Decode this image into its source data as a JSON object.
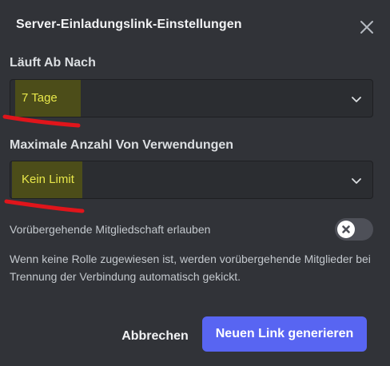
{
  "modal": {
    "title": "Server-Einladungslink-Einstellungen"
  },
  "expire": {
    "label": "Läuft Ab Nach",
    "value": "7 Tage"
  },
  "max_uses": {
    "label": "Maximale Anzahl Von Verwendungen",
    "value": "Kein Limit"
  },
  "temporary": {
    "label": "Vorübergehende Mitgliedschaft erlauben",
    "enabled": false,
    "description": "Wenn keine Rolle zugewiesen ist, werden vorübergehende Mitglieder bei Trennung der Verbindung automatisch gekickt."
  },
  "footer": {
    "cancel_label": "Abbrechen",
    "generate_label": "Neuen Link generieren"
  },
  "colors": {
    "background": "#313338",
    "select_bg": "#2b2d31",
    "accent": "#5865f2",
    "highlight_text": "#e8e84a",
    "annotation": "#e0151b"
  },
  "icons": {
    "close": "close-icon",
    "dropdown": "chevron-down-icon",
    "toggle_off": "x-icon"
  }
}
